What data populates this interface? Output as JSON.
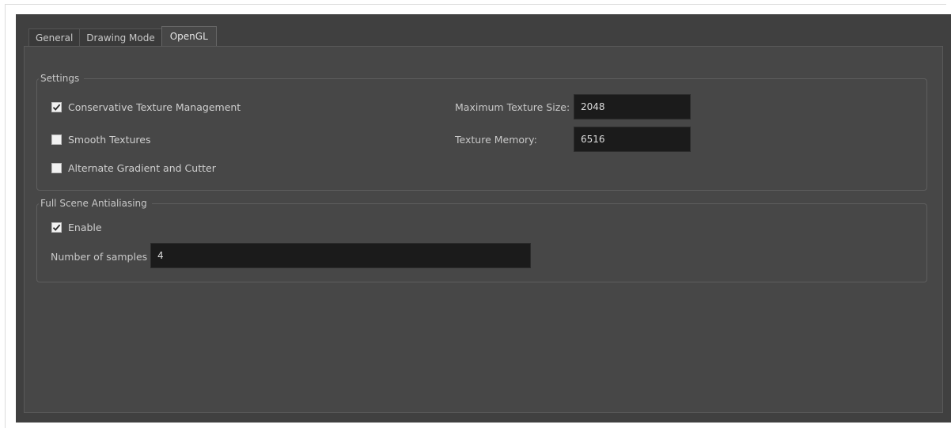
{
  "tabs": [
    {
      "label": "General",
      "active": false
    },
    {
      "label": "Drawing Mode",
      "active": false
    },
    {
      "label": "OpenGL",
      "active": true
    }
  ],
  "settings": {
    "title": "Settings",
    "conservative_texture": {
      "label": "Conservative Texture Management",
      "checked": true
    },
    "smooth_textures": {
      "label": "Smooth Textures",
      "checked": false
    },
    "alternate_gradient": {
      "label": "Alternate Gradient and Cutter",
      "checked": false
    },
    "max_texture_size": {
      "label": "Maximum Texture Size:",
      "value": "2048"
    },
    "texture_memory": {
      "label": "Texture Memory:",
      "value": "6516"
    }
  },
  "fsaa": {
    "title": "Full Scene Antialiasing",
    "enable": {
      "label": "Enable",
      "checked": true
    },
    "samples": {
      "label": "Number of samples",
      "value": "4"
    }
  },
  "colors": {
    "window_bg": "#404040",
    "panel_bg": "#474747",
    "field_bg": "#1b1b1b"
  }
}
